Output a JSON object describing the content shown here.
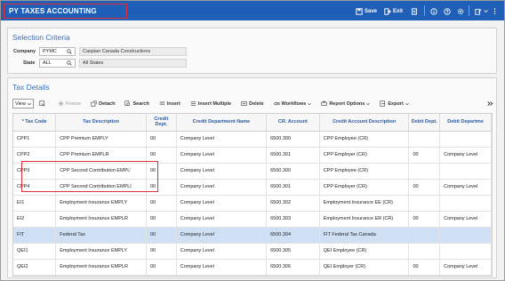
{
  "window": {
    "title": "PY TAXES ACCOUNTING"
  },
  "header_toolbar": {
    "save": "Save",
    "exit": "Exit"
  },
  "selection_criteria": {
    "title": "Selection Criteria",
    "company_label": "Company",
    "company_value": "PYMC",
    "company_name": "Caspian Canada Constructions",
    "state_label": "State",
    "state_value": "ALL",
    "state_name": "All States"
  },
  "tax_details": {
    "title": "Tax Details",
    "view_label": "View",
    "toolbar": {
      "freeze": "Freeze",
      "detach": "Detach",
      "search": "Search",
      "insert": "Insert",
      "insert_multiple": "Insert Multiple",
      "delete": "Delete",
      "workflows": "Workflows",
      "report_options": "Report Options",
      "export": "Export"
    },
    "columns": [
      "* Tax Code",
      "Tax Description",
      "Credit Dept.",
      "Credit Department Name",
      "CR. Account",
      "Credit Account Description",
      "Debit Dept.",
      "Debit Departme"
    ],
    "rows": [
      [
        "CPP1",
        "CPP Premium EMPLY",
        "00",
        "Company Level",
        "6500.300",
        "CPP Employee (CR)",
        "",
        ""
      ],
      [
        "CPP2",
        "CPP Premium EMPLR",
        "00",
        "Company Level",
        "6500.301",
        "CPP Employer (CR)",
        "00",
        "Company Level"
      ],
      [
        "CPP3",
        "CPP Second Contribution EMPL'",
        "00",
        "Company Level",
        "6500.300",
        "CPP Employee (CR)",
        "",
        ""
      ],
      [
        "CPP4",
        "CPP Second Contribution EMPLI",
        "00",
        "Company Level",
        "6500.301",
        "CPP Employer (CR)",
        "00",
        "Company Level"
      ],
      [
        "EI1",
        "Employment Insurance EMPLY",
        "00",
        "Company Level",
        "6500.302",
        "Employment Insurance EE (CR)",
        "",
        ""
      ],
      [
        "EI2",
        "Employment Insurance EMPLR",
        "00",
        "Company Level",
        "6500.303",
        "Employment Insurance ER (CR)",
        "00",
        "Company Level"
      ],
      [
        "FIT",
        "Federal Tax",
        "00",
        "Company Level",
        "6500.304",
        "FIT Federal Tax Canada",
        "",
        ""
      ],
      [
        "QEI1",
        "Employment Insurance EMPLY",
        "00",
        "Company Level",
        "6500.305",
        "QEI Employee (CR)",
        "",
        ""
      ],
      [
        "QEI2",
        "Employment Insurance EMPLR",
        "00",
        "Company Level",
        "6500.306",
        "QEI Employer (CR)",
        "00",
        "Company Level"
      ]
    ],
    "selected_row": 6
  }
}
